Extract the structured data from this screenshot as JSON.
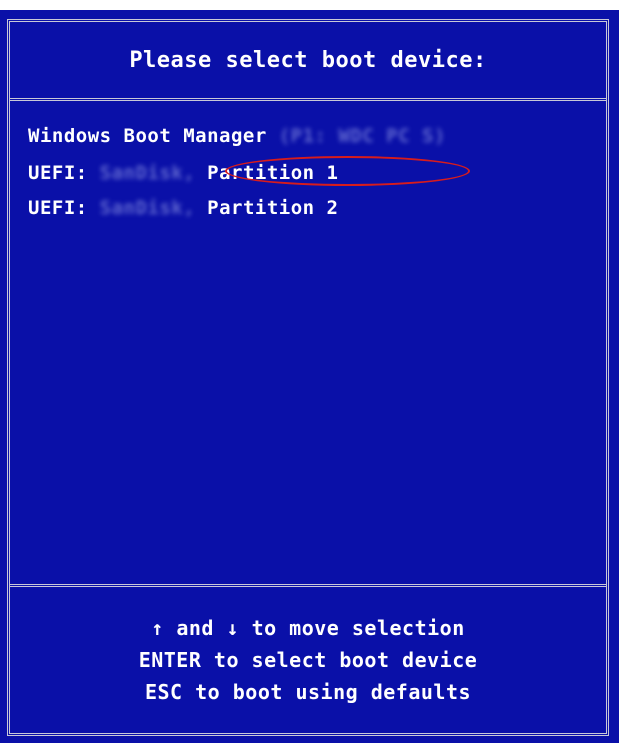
{
  "boot_menu": {
    "title": "Please select boot device:",
    "items": [
      {
        "label": "Windows Boot Manager",
        "detail": "(P1: WDC PC S)"
      },
      {
        "label": "UEFI:",
        "detail": "SanDisk,",
        "suffix": "Partition 1"
      },
      {
        "label": "UEFI:",
        "detail": "SanDisk,",
        "suffix": "Partition 2"
      }
    ],
    "hints": [
      "↑ and ↓ to move selection",
      "ENTER to select boot device",
      "ESC to boot using defaults"
    ]
  },
  "colors": {
    "background": "#0a10a8",
    "text": "#ffffff",
    "border": "#c8c8d8",
    "annotation_ring": "#d81c1c"
  }
}
